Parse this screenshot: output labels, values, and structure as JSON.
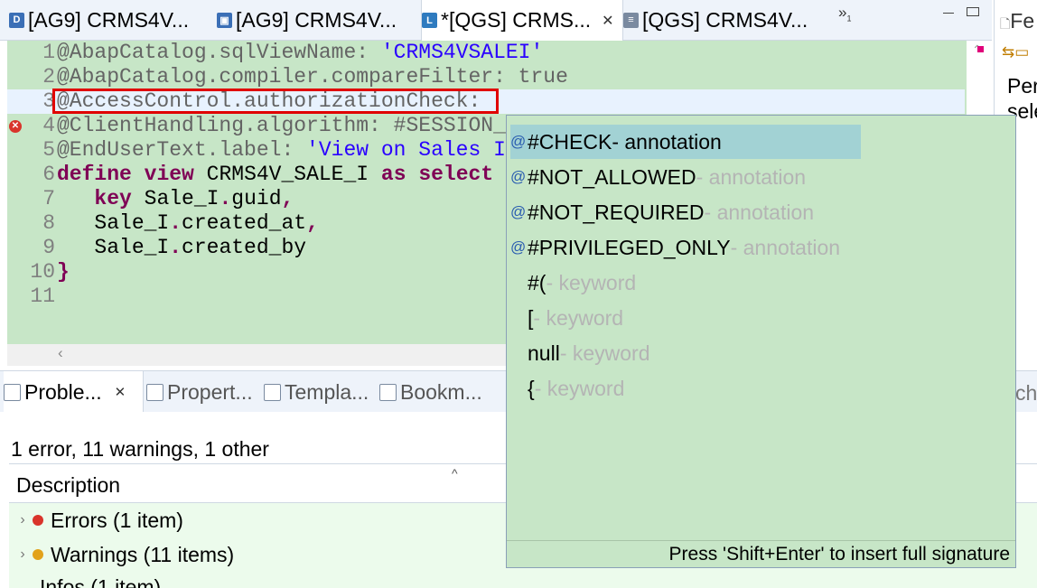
{
  "editor_tabs": [
    {
      "label": "[AG9] CRMS4V...",
      "icon": "ddic-icon",
      "icon_glyph": "D",
      "color": "#3b6fb6",
      "active": false
    },
    {
      "label": "[AG9] CRMS4V...",
      "icon": "ddl-source-icon",
      "icon_glyph": "▣",
      "color": "#3b6fb6",
      "active": false
    },
    {
      "label": "*[QGS] CRMS...",
      "icon": "cds-view-icon",
      "icon_glyph": "L",
      "color": "#2f7bbf",
      "active": true,
      "close": "✕"
    },
    {
      "label": "[QGS] CRMS4V...",
      "icon": "ddl-file-icon",
      "icon_glyph": "≡",
      "color": "#7a8aa0",
      "active": false
    }
  ],
  "overflow": {
    "glyph": "»",
    "count": "1"
  },
  "right_panel": {
    "tab_label": "Fe",
    "text_line1": "Per",
    "text_line2": "sele"
  },
  "editor": {
    "line_numbers": [
      "1",
      "2",
      "3",
      "4",
      "5",
      "6",
      "7",
      "8",
      "9",
      "10",
      "11"
    ],
    "lines": [
      [
        {
          "t": "@AbapCatalog.sqlViewName: ",
          "c": "ann"
        },
        {
          "t": "'CRMS4VSALEI'",
          "c": "str"
        }
      ],
      [
        {
          "t": "@AbapCatalog.compiler.compareFilter: true",
          "c": "ann"
        }
      ],
      [
        {
          "t": "@AccessControl.authorizationCheck:",
          "c": "ann"
        }
      ],
      [
        {
          "t": "@ClientHandling.algorithm: #SESSION_",
          "c": "ann"
        }
      ],
      [
        {
          "t": "@EndUserText.label: ",
          "c": "ann"
        },
        {
          "t": "'View on Sales I",
          "c": "str"
        }
      ],
      [
        {
          "t": "define",
          "c": "kw"
        },
        {
          "t": " ",
          "c": "plain"
        },
        {
          "t": "view",
          "c": "kw"
        },
        {
          "t": " CRMS4V_SALE_I ",
          "c": "plain"
        },
        {
          "t": "as",
          "c": "kw"
        },
        {
          "t": " ",
          "c": "plain"
        },
        {
          "t": "select",
          "c": "kw"
        }
      ],
      [
        {
          "t": "   ",
          "c": "plain"
        },
        {
          "t": "key",
          "c": "kw"
        },
        {
          "t": " Sale_I",
          "c": "plain"
        },
        {
          "t": ".",
          "c": "op"
        },
        {
          "t": "guid",
          "c": "plain"
        },
        {
          "t": ",",
          "c": "op"
        }
      ],
      [
        {
          "t": "   Sale_I",
          "c": "plain"
        },
        {
          "t": ".",
          "c": "op"
        },
        {
          "t": "created_at",
          "c": "plain"
        },
        {
          "t": ",",
          "c": "op"
        }
      ],
      [
        {
          "t": "   Sale_I",
          "c": "plain"
        },
        {
          "t": ".",
          "c": "op"
        },
        {
          "t": "created_by",
          "c": "plain"
        }
      ],
      [
        {
          "t": "}",
          "c": "kw"
        }
      ],
      []
    ]
  },
  "content_assist": {
    "proposals": [
      {
        "name": "#CHECK",
        "desc": " - annotation",
        "icon": "@",
        "selected": true
      },
      {
        "name": "#NOT_ALLOWED",
        "desc": " - annotation",
        "icon": "@",
        "selected": false
      },
      {
        "name": "#NOT_REQUIRED",
        "desc": " - annotation",
        "icon": "@",
        "selected": false
      },
      {
        "name": "#PRIVILEGED_ONLY",
        "desc": " - annotation",
        "icon": "@",
        "selected": false
      },
      {
        "name": "#(",
        "desc": " - keyword",
        "icon": "",
        "selected": false
      },
      {
        "name": "[",
        "desc": " - keyword",
        "icon": "",
        "selected": false
      },
      {
        "name": "null",
        "desc": " - keyword",
        "icon": "",
        "selected": false
      },
      {
        "name": "{",
        "desc": " - keyword",
        "icon": "",
        "selected": false
      }
    ],
    "footer": "Press 'Shift+Enter' to insert full signature"
  },
  "view_tabs": [
    {
      "label": "Proble...",
      "active": true,
      "close": "✕"
    },
    {
      "label": "Propert...",
      "active": false
    },
    {
      "label": "Templa...",
      "active": false
    },
    {
      "label": "Bookm...",
      "active": false
    }
  ],
  "view_tab_right_fragment": "ch",
  "problems": {
    "summary": "1 error, 11 warnings, 1 other",
    "column_header": "Description",
    "rows": [
      {
        "label": "Errors (1 item)",
        "color": "#d9342b",
        "expand": "›"
      },
      {
        "label": "Warnings (11 items)",
        "color": "#e2a21b",
        "expand": "›"
      }
    ],
    "partial_row": "Infos (1 item)"
  }
}
